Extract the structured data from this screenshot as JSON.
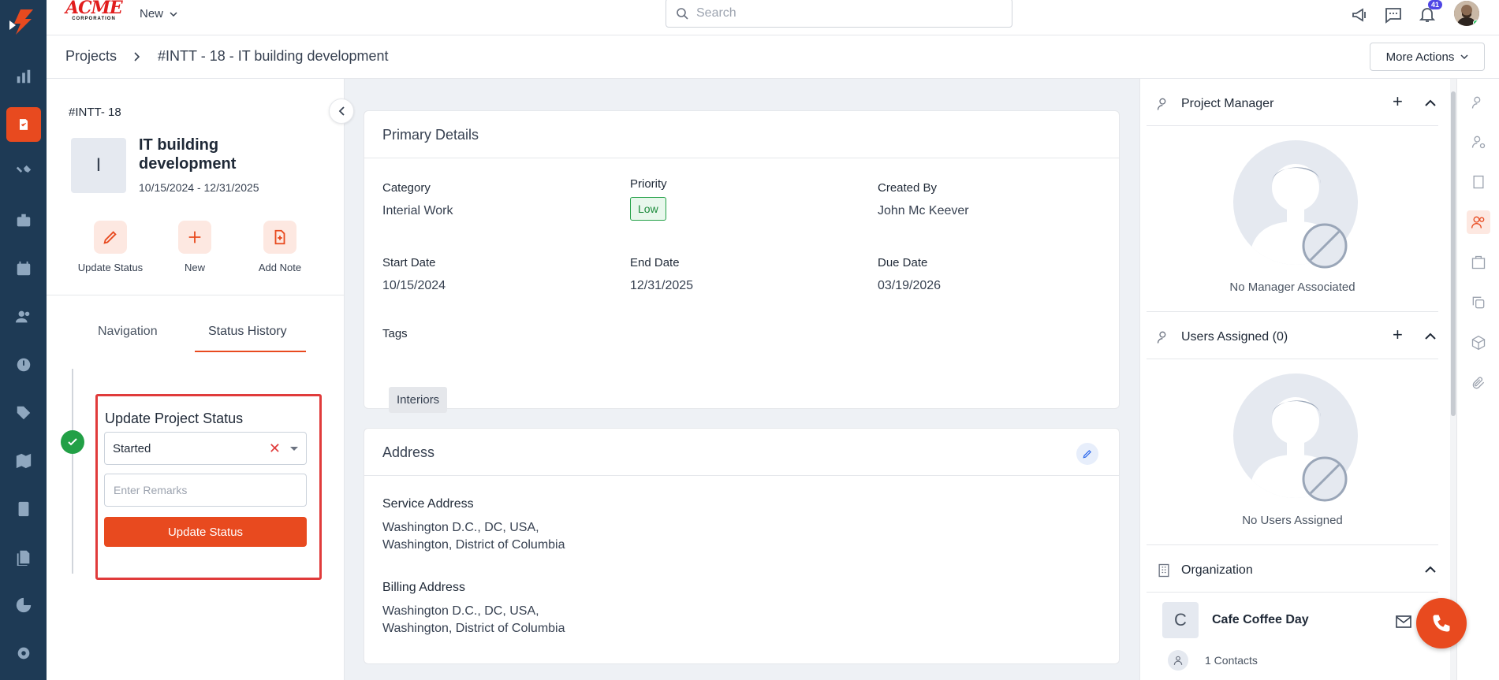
{
  "topbar": {
    "logo_text": "ACME",
    "logo_sub": "CORPORATION",
    "new_label": "New",
    "search_placeholder": "Search",
    "notification_count": "41"
  },
  "breadcrumb": {
    "root": "Projects",
    "current": "#INTT - 18 - IT building development"
  },
  "more_actions": "More Actions",
  "project": {
    "code": "#INTT- 18",
    "initial": "I",
    "title": "IT building development",
    "dates": "10/15/2024 - 12/31/2025"
  },
  "quick_actions": [
    {
      "label": "Update Status",
      "icon": "pencil-icon"
    },
    {
      "label": "New",
      "icon": "plus-icon"
    },
    {
      "label": "Add Note",
      "icon": "note-add-icon"
    }
  ],
  "tabs": [
    "Navigation",
    "Status History"
  ],
  "status_form": {
    "title": "Update Project Status",
    "selected_status": "Started",
    "remarks_placeholder": "Enter Remarks",
    "button": "Update Status"
  },
  "primary_details": {
    "title": "Primary Details",
    "category_label": "Category",
    "category": "Interial Work",
    "priority_label": "Priority",
    "priority": "Low",
    "created_by_label": "Created By",
    "created_by": "John Mc Keever",
    "start_label": "Start Date",
    "start": "10/15/2024",
    "end_label": "End Date",
    "end": "12/31/2025",
    "due_label": "Due Date",
    "due": "03/19/2026",
    "tags_label": "Tags",
    "tag": "Interiors"
  },
  "address": {
    "title": "Address",
    "service_label": "Service Address",
    "service_line1": "Washington D.C., DC, USA,",
    "service_line2": "Washington, District of Columbia",
    "billing_label": "Billing Address",
    "billing_line1": "Washington D.C., DC, USA,",
    "billing_line2": "Washington, District of Columbia"
  },
  "right_panel": {
    "manager_title": "Project Manager",
    "manager_empty": "No Manager Associated",
    "users_title": "Users Assigned (0)",
    "users_empty": "No Users Assigned",
    "org_title": "Organization",
    "org_initial": "C",
    "org_name": "Cafe Coffee Day",
    "org_contacts": "1 Contacts"
  },
  "colors": {
    "accent": "#e84a1f",
    "nav_bg": "#1e3a55",
    "success": "#22a046",
    "highlight_border": "#e03b3b"
  }
}
